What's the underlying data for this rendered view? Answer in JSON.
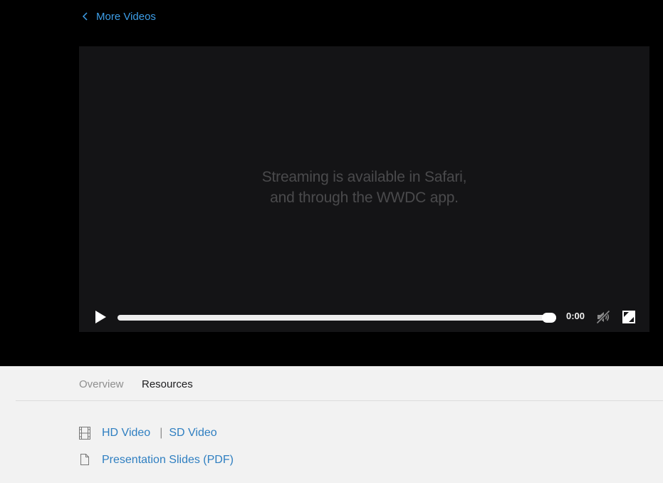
{
  "nav": {
    "back_label": "More Videos"
  },
  "player": {
    "message_line1": "Streaming is available in Safari,",
    "message_line2": "and through the WWDC app.",
    "time": "0:00",
    "progress_fraction": 1.0
  },
  "tabs": [
    {
      "label": "Overview",
      "active": false
    },
    {
      "label": "Resources",
      "active": true
    }
  ],
  "resources": {
    "video_links": [
      {
        "label": "HD Video"
      },
      {
        "label": "SD Video"
      }
    ],
    "separator": "|",
    "slides_label": "Presentation Slides (PDF)"
  },
  "icons": {
    "back": "chevron-left-icon",
    "play": "play-icon",
    "mute": "volume-muted-icon",
    "fullscreen": "fullscreen-icon",
    "video": "film-icon",
    "document": "document-icon"
  },
  "colors": {
    "link": "#3d9ee8",
    "resource_link": "#2f7fc1",
    "player_bg": "#141416",
    "page_bg": "#f2f2f2"
  }
}
